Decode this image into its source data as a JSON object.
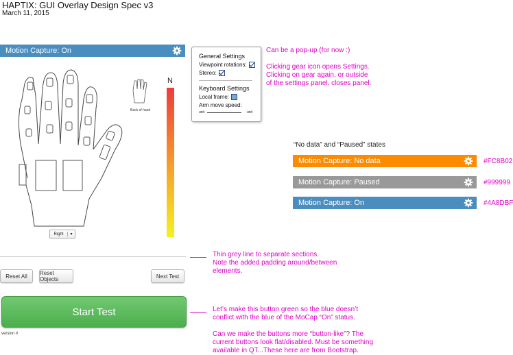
{
  "doc": {
    "title": "HAPTIX: GUI Overlay Design Spec v3",
    "date": "March 11, 2015"
  },
  "main_bar": {
    "label": "Motion Capture: On",
    "color": "#4A8DBF"
  },
  "hand": {
    "back_label": "Back of hand",
    "scale_label": "N",
    "side_select": "Right",
    "colors": {
      "scale_top": "#ef3b3b",
      "scale_mid": "#f7a32b",
      "scale_bottom": "#f5f020"
    }
  },
  "settings_panel": {
    "general_heading": "General Settings",
    "viewpoint_label": "Viewpoint rotations:",
    "stereo_label": "Stereo:",
    "keyboard_heading": "Keyboard Settings",
    "local_frame_label": "Local frame:",
    "arm_speed_label": "Arm move speed:",
    "slider_min_label": "unit",
    "slider_max_label": "unit",
    "viewpoint_checked": true,
    "stereo_checked": true,
    "local_frame_checked": false
  },
  "notes": {
    "popup_note": "Can be a pop-up (for now :)",
    "gear_note_1": "Clicking gear icon opens Settings.",
    "gear_note_2": "Clicking on gear again, or outside",
    "gear_note_3": "of the settings panel, closes panel.",
    "states_heading": "“No data” and “Paused” states",
    "line_note_1": "Thin grey line to separate sections.",
    "line_note_2": "Note the added padding around/between",
    "line_note_3": "elements.",
    "green_note_1": "Let’s make this button green so the blue doesn’t",
    "green_note_2": "conflict with the blue of the MoCap “On” status.",
    "button_note_1": "Can we make the buttons more “button-like”? The",
    "button_note_2": "current buttons look flat/disabled. Must be something",
    "button_note_3": "available in QT...These here are from Bootstrap."
  },
  "states": [
    {
      "label": "Motion Capture: No data",
      "color": "#FC8B02",
      "hex": "#FC8B02"
    },
    {
      "label": "Motion Capture: Paused",
      "color": "#999999",
      "hex": "#999999"
    },
    {
      "label": "Motion Capture: On",
      "color": "#4A8DBF",
      "hex": "#4A8DBF"
    }
  ],
  "buttons": {
    "reset_all": "Reset All",
    "reset_objects": "Reset Objects",
    "next_test": "Next Test",
    "start_test": "Start Test",
    "start_color": "#5cb85c"
  },
  "version_label": "version #"
}
